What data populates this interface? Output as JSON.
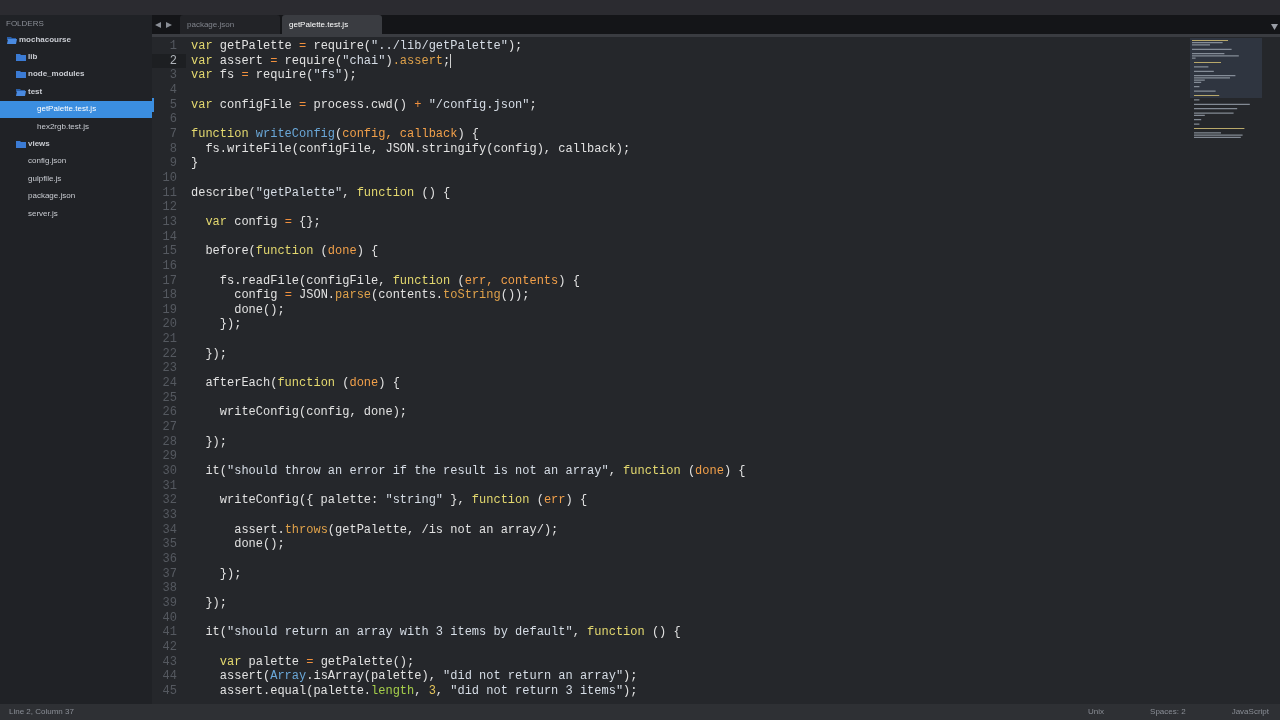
{
  "sidebar": {
    "header": "FOLDERS",
    "items": [
      {
        "name": "mochacourse",
        "kind": "folder",
        "expanded": true,
        "selected": false,
        "children": [
          {
            "name": "lib",
            "kind": "folder",
            "expanded": false,
            "selected": false
          },
          {
            "name": "node_modules",
            "kind": "folder",
            "expanded": false,
            "selected": false
          },
          {
            "name": "test",
            "kind": "folder",
            "expanded": true,
            "selected": false,
            "children": [
              {
                "name": "getPalette.test.js",
                "kind": "file",
                "selected": true
              },
              {
                "name": "hex2rgb.test.js",
                "kind": "file",
                "selected": false
              }
            ]
          },
          {
            "name": "views",
            "kind": "folder",
            "expanded": false,
            "selected": false
          },
          {
            "name": "config.json",
            "kind": "file",
            "selected": false
          },
          {
            "name": "gulpfile.js",
            "kind": "file",
            "selected": false
          },
          {
            "name": "package.json",
            "kind": "file",
            "selected": false
          },
          {
            "name": "server.js",
            "kind": "file",
            "selected": false
          }
        ]
      }
    ]
  },
  "tabs": [
    {
      "label": "package.json",
      "selected": false
    },
    {
      "label": "getPalette.test.js",
      "selected": true
    }
  ],
  "editor": {
    "lines": [
      {
        "number": "1",
        "current": false,
        "modified": false,
        "tokens": [
          {
            "text": "var",
            "kind": "keyword"
          },
          {
            "text": " getPalette ",
            "kind": "plain"
          },
          {
            "text": "=",
            "kind": "operator"
          },
          {
            "text": " require(",
            "kind": "plain"
          },
          {
            "text": "\"../lib/getPalette\"",
            "kind": "string"
          },
          {
            "text": ");",
            "kind": "plain"
          }
        ]
      },
      {
        "number": "2",
        "current": true,
        "modified": false,
        "tokens": [
          {
            "text": "var",
            "kind": "keyword"
          },
          {
            "text": " assert ",
            "kind": "plain"
          },
          {
            "text": "=",
            "kind": "operator"
          },
          {
            "text": " require(",
            "kind": "plain"
          },
          {
            "text": "\"chai\"",
            "kind": "string"
          },
          {
            "text": ")",
            "kind": "plain"
          },
          {
            "text": ".assert",
            "kind": "method"
          },
          {
            "text": ";",
            "kind": "plain"
          }
        ]
      },
      {
        "number": "3",
        "current": false,
        "modified": false,
        "tokens": [
          {
            "text": "var",
            "kind": "keyword"
          },
          {
            "text": " fs ",
            "kind": "plain"
          },
          {
            "text": "=",
            "kind": "operator"
          },
          {
            "text": " require(",
            "kind": "plain"
          },
          {
            "text": "\"fs\"",
            "kind": "string"
          },
          {
            "text": ");",
            "kind": "plain"
          }
        ]
      },
      {
        "number": "4",
        "current": false,
        "modified": false
      },
      {
        "number": "5",
        "current": false,
        "modified": true,
        "tokens": [
          {
            "text": "var",
            "kind": "keyword"
          },
          {
            "text": " configFile ",
            "kind": "plain"
          },
          {
            "text": "=",
            "kind": "operator"
          },
          {
            "text": " process.cwd() ",
            "kind": "plain"
          },
          {
            "text": "+",
            "kind": "operator"
          },
          {
            "text": " \"/config.json\"",
            "kind": "string"
          },
          {
            "text": ";",
            "kind": "plain"
          }
        ]
      },
      {
        "number": "6",
        "current": false,
        "modified": false
      },
      {
        "number": "7",
        "current": false,
        "modified": false,
        "tokens": [
          {
            "text": "function",
            "kind": "keyword"
          },
          {
            "text": " writeConfig",
            "kind": "name"
          },
          {
            "text": "(",
            "kind": "plain"
          },
          {
            "text": "config, callback",
            "kind": "param"
          },
          {
            "text": ") {",
            "kind": "plain"
          }
        ]
      },
      {
        "number": "8",
        "current": false,
        "modified": false,
        "tokens": [
          {
            "text": "  fs.writeFile(configFile, JSON.stringify(config), callback);",
            "kind": "plain"
          }
        ]
      },
      {
        "number": "9",
        "current": false,
        "modified": false,
        "tokens": [
          {
            "text": "}",
            "kind": "plain"
          }
        ]
      },
      {
        "number": "10",
        "current": false,
        "modified": false
      },
      {
        "number": "11",
        "current": false,
        "modified": false,
        "tokens": [
          {
            "text": "describe(",
            "kind": "plain"
          },
          {
            "text": "\"getPalette\"",
            "kind": "string"
          },
          {
            "text": ", ",
            "kind": "plain"
          },
          {
            "text": "function",
            "kind": "keyword"
          },
          {
            "text": " () {",
            "kind": "plain"
          }
        ]
      },
      {
        "number": "12",
        "current": false,
        "modified": false
      },
      {
        "number": "13",
        "current": false,
        "modified": false,
        "tokens": [
          {
            "text": "  var",
            "kind": "keyword"
          },
          {
            "text": " config ",
            "kind": "plain"
          },
          {
            "text": "=",
            "kind": "operator"
          },
          {
            "text": " {};",
            "kind": "plain"
          }
        ]
      },
      {
        "number": "14",
        "current": false,
        "modified": false
      },
      {
        "number": "15",
        "current": false,
        "modified": false,
        "tokens": [
          {
            "text": "  before(",
            "kind": "plain"
          },
          {
            "text": "function",
            "kind": "keyword"
          },
          {
            "text": " (",
            "kind": "plain"
          },
          {
            "text": "done",
            "kind": "param"
          },
          {
            "text": ") {",
            "kind": "plain"
          }
        ]
      },
      {
        "number": "16",
        "current": false,
        "modified": false
      },
      {
        "number": "17",
        "current": false,
        "modified": false,
        "tokens": [
          {
            "text": "    fs.readFile(configFile, ",
            "kind": "plain"
          },
          {
            "text": "function",
            "kind": "keyword"
          },
          {
            "text": " (",
            "kind": "plain"
          },
          {
            "text": "err, contents",
            "kind": "param"
          },
          {
            "text": ") {",
            "kind": "plain"
          }
        ]
      },
      {
        "number": "18",
        "current": false,
        "modified": false,
        "tokens": [
          {
            "text": "      config ",
            "kind": "plain"
          },
          {
            "text": "=",
            "kind": "operator"
          },
          {
            "text": " JSON.",
            "kind": "plain"
          },
          {
            "text": "parse",
            "kind": "method"
          },
          {
            "text": "(contents.",
            "kind": "plain"
          },
          {
            "text": "toString",
            "kind": "method"
          },
          {
            "text": "());",
            "kind": "plain"
          }
        ]
      },
      {
        "number": "19",
        "current": false,
        "modified": false,
        "tokens": [
          {
            "text": "      done();",
            "kind": "plain"
          }
        ]
      },
      {
        "number": "20",
        "current": false,
        "modified": false,
        "tokens": [
          {
            "text": "    });",
            "kind": "plain"
          }
        ]
      },
      {
        "number": "21",
        "current": false,
        "modified": false
      },
      {
        "number": "22",
        "current": false,
        "modified": false,
        "tokens": [
          {
            "text": "  });",
            "kind": "plain"
          }
        ]
      },
      {
        "number": "23",
        "current": false,
        "modified": false
      },
      {
        "number": "24",
        "current": false,
        "modified": false,
        "tokens": [
          {
            "text": "  afterEach(",
            "kind": "plain"
          },
          {
            "text": "function",
            "kind": "keyword"
          },
          {
            "text": " (",
            "kind": "plain"
          },
          {
            "text": "done",
            "kind": "param"
          },
          {
            "text": ") {",
            "kind": "plain"
          }
        ]
      },
      {
        "number": "25",
        "current": false,
        "modified": false
      },
      {
        "number": "26",
        "current": false,
        "modified": false,
        "tokens": [
          {
            "text": "    writeConfig(config, done);",
            "kind": "plain"
          }
        ]
      },
      {
        "number": "27",
        "current": false,
        "modified": false
      },
      {
        "number": "28",
        "current": false,
        "modified": false,
        "tokens": [
          {
            "text": "  });",
            "kind": "plain"
          }
        ]
      },
      {
        "number": "29",
        "current": false,
        "modified": false
      },
      {
        "number": "30",
        "current": false,
        "modified": false,
        "tokens": [
          {
            "text": "  it(",
            "kind": "plain"
          },
          {
            "text": "\"should throw an error if the result is not an array\"",
            "kind": "string"
          },
          {
            "text": ", ",
            "kind": "plain"
          },
          {
            "text": "function",
            "kind": "keyword"
          },
          {
            "text": " (",
            "kind": "plain"
          },
          {
            "text": "done",
            "kind": "param"
          },
          {
            "text": ") {",
            "kind": "plain"
          }
        ]
      },
      {
        "number": "31",
        "current": false,
        "modified": false
      },
      {
        "number": "32",
        "current": false,
        "modified": false,
        "tokens": [
          {
            "text": "    writeConfig({ palette: ",
            "kind": "plain"
          },
          {
            "text": "\"string\"",
            "kind": "string"
          },
          {
            "text": " }, ",
            "kind": "plain"
          },
          {
            "text": "function",
            "kind": "keyword"
          },
          {
            "text": " (",
            "kind": "plain"
          },
          {
            "text": "err",
            "kind": "param"
          },
          {
            "text": ") {",
            "kind": "plain"
          }
        ]
      },
      {
        "number": "33",
        "current": false,
        "modified": false
      },
      {
        "number": "34",
        "current": false,
        "modified": false,
        "tokens": [
          {
            "text": "      assert.",
            "kind": "plain"
          },
          {
            "text": "throws",
            "kind": "method"
          },
          {
            "text": "(getPalette, /is not an array/);",
            "kind": "plain"
          }
        ]
      },
      {
        "number": "35",
        "current": false,
        "modified": false,
        "tokens": [
          {
            "text": "      done();",
            "kind": "plain"
          }
        ]
      },
      {
        "number": "36",
        "current": false,
        "modified": false
      },
      {
        "number": "37",
        "current": false,
        "modified": false,
        "tokens": [
          {
            "text": "    });",
            "kind": "plain"
          }
        ]
      },
      {
        "number": "38",
        "current": false,
        "modified": false
      },
      {
        "number": "39",
        "current": false,
        "modified": false,
        "tokens": [
          {
            "text": "  });",
            "kind": "plain"
          }
        ]
      },
      {
        "number": "40",
        "current": false,
        "modified": false
      },
      {
        "number": "41",
        "current": false,
        "modified": false,
        "tokens": [
          {
            "text": "  it(",
            "kind": "plain"
          },
          {
            "text": "\"should return an array with 3 items by default\"",
            "kind": "string"
          },
          {
            "text": ", ",
            "kind": "plain"
          },
          {
            "text": "function",
            "kind": "keyword"
          },
          {
            "text": " () {",
            "kind": "plain"
          }
        ]
      },
      {
        "number": "42",
        "current": false,
        "modified": false
      },
      {
        "number": "43",
        "current": false,
        "modified": false,
        "tokens": [
          {
            "text": "    var",
            "kind": "keyword"
          },
          {
            "text": " palette ",
            "kind": "plain"
          },
          {
            "text": "=",
            "kind": "operator"
          },
          {
            "text": " getPalette();",
            "kind": "plain"
          }
        ]
      },
      {
        "number": "44",
        "current": false,
        "modified": false,
        "tokens": [
          {
            "text": "    assert(",
            "kind": "plain"
          },
          {
            "text": "Array",
            "kind": "builtin"
          },
          {
            "text": ".isArray(palette), ",
            "kind": "plain"
          },
          {
            "text": "\"did not return an array\"",
            "kind": "string"
          },
          {
            "text": ");",
            "kind": "plain"
          }
        ]
      },
      {
        "number": "45",
        "current": false,
        "modified": false,
        "tokens": [
          {
            "text": "    assert.equal(palette.",
            "kind": "plain"
          },
          {
            "text": "length",
            "kind": "property"
          },
          {
            "text": ", ",
            "kind": "plain"
          },
          {
            "text": "3",
            "kind": "number"
          },
          {
            "text": ", ",
            "kind": "plain"
          },
          {
            "text": "\"did not return 3 items\"",
            "kind": "string"
          },
          {
            "text": ");",
            "kind": "plain"
          }
        ]
      }
    ]
  },
  "status_bar": {
    "position": "Line 2, Column 37",
    "items": [
      "Unix",
      "Spaces: 2",
      "JavaScript"
    ]
  }
}
